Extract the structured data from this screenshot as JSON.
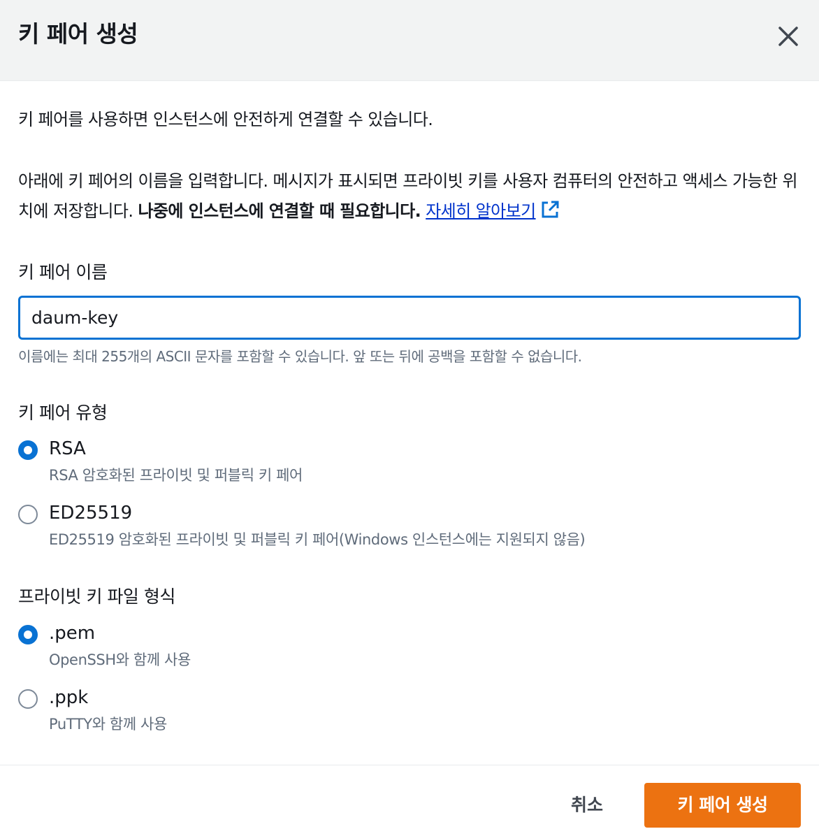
{
  "header": {
    "title": "키 페어 생성",
    "close_icon": "close-icon"
  },
  "intro": "키 페어를 사용하면 인스턴스에 안전하게 연결할 수 있습니다.",
  "description": {
    "text": "아래에 키 페어의 이름을 입력합니다. 메시지가 표시되면 프라이빗 키를 사용자 컴퓨터의 안전하고 액세스 가능한 위치에 저장합니다. ",
    "bold_text": "나중에 인스턴스에 연결할 때 필요합니다.",
    "link_text": "자세히 알아보기",
    "link_icon": "external-link-icon"
  },
  "name_field": {
    "label": "키 페어 이름",
    "value": "daum-key",
    "hint": "이름에는 최대 255개의 ASCII 문자를 포함할 수 있습니다. 앞 또는 뒤에 공백을 포함할 수 없습니다."
  },
  "key_type": {
    "label": "키 페어 유형",
    "options": [
      {
        "label": "RSA",
        "description": "RSA 암호화된 프라이빗 및 퍼블릭 키 페어",
        "checked": true
      },
      {
        "label": "ED25519",
        "description": "ED25519 암호화된 프라이빗 및 퍼블릭 키 페어(Windows 인스턴스에는 지원되지 않음)",
        "checked": false
      }
    ]
  },
  "file_format": {
    "label": "프라이빗 키 파일 형식",
    "options": [
      {
        "label": ".pem",
        "description": "OpenSSH와 함께 사용",
        "checked": true
      },
      {
        "label": ".ppk",
        "description": "PuTTY와 함께 사용",
        "checked": false
      }
    ]
  },
  "footer": {
    "cancel_label": "취소",
    "create_label": "키 페어 생성"
  },
  "colors": {
    "primary_button": "#ec7211",
    "focus_border": "#0972d3",
    "link": "#0033cc",
    "header_bg": "#f2f3f3"
  }
}
